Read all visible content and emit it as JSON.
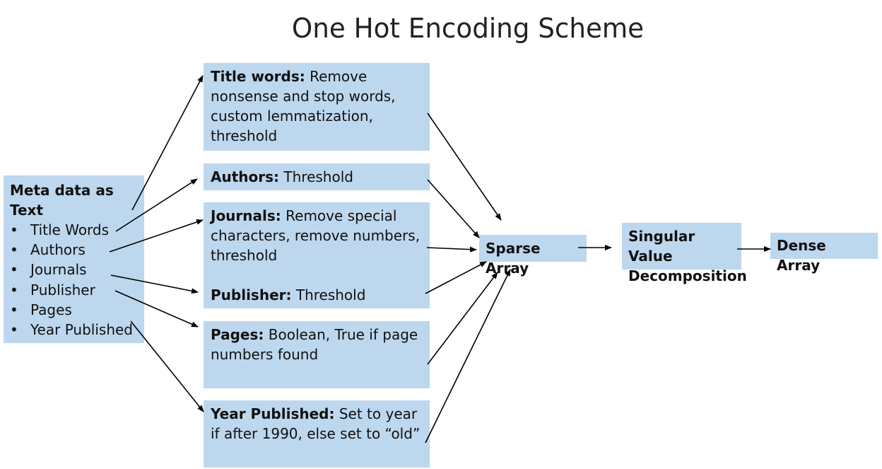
{
  "title": "One Hot Encoding Scheme",
  "meta_box": {
    "heading": "Meta data as Text",
    "items": [
      "Title Words",
      "Authors",
      "Journals",
      "Publisher",
      "Pages",
      "Year Published"
    ]
  },
  "steps": {
    "title_words": {
      "label": "Title words:",
      "text": " Remove nonsense and stop words, custom lemmatization, threshold"
    },
    "authors": {
      "label": "Authors:",
      "text": " Threshold"
    },
    "journals": {
      "label": "Journals:",
      "text": " Remove special characters, remove numbers, threshold"
    },
    "publisher": {
      "label": "Publisher:",
      "text": " Threshold"
    },
    "pages": {
      "label": "Pages:",
      "text": " Boolean, True if page numbers found"
    },
    "year": {
      "label": "Year Published:",
      "text": " Set to year if after 1990, else set to “old”"
    }
  },
  "sparse": "Sparse Array",
  "svd": {
    "line1": "Singular Value",
    "line2": "Decomposition"
  },
  "dense": "Dense Array",
  "colors": {
    "box_fill": "#bdd7ee",
    "arrow": "#000000"
  }
}
